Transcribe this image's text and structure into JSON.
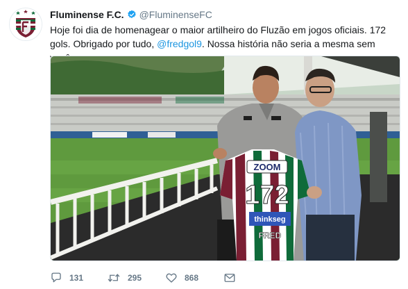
{
  "tweet": {
    "display_name": "Fluminense F.C.",
    "handle": "@FluminenseFC",
    "text_before": "Hoje foi dia de homenagear o maior artilheiro do Fluzão em jogos oficiais. 172 gols. Obrigado por tudo, ",
    "mention": "@fredgol9",
    "text_after": ". Nossa história não seria a mesma sem você.",
    "replies": "131",
    "retweets": "295",
    "likes": "868"
  },
  "photo": {
    "jersey_sponsor_top": "ZOOM",
    "jersey_number": "172",
    "jersey_sponsor_bottom": "thinkseg",
    "jersey_name": "FRED"
  },
  "colors": {
    "verified": "#1da1f2",
    "link": "#1b95e0",
    "muted": "#657786",
    "club_grena": "#7a1f33",
    "club_green": "#0f6b3a"
  },
  "icons": {
    "verified": "verified-badge-icon",
    "reply": "reply-icon",
    "retweet": "retweet-icon",
    "like": "heart-icon",
    "dm": "envelope-icon"
  }
}
